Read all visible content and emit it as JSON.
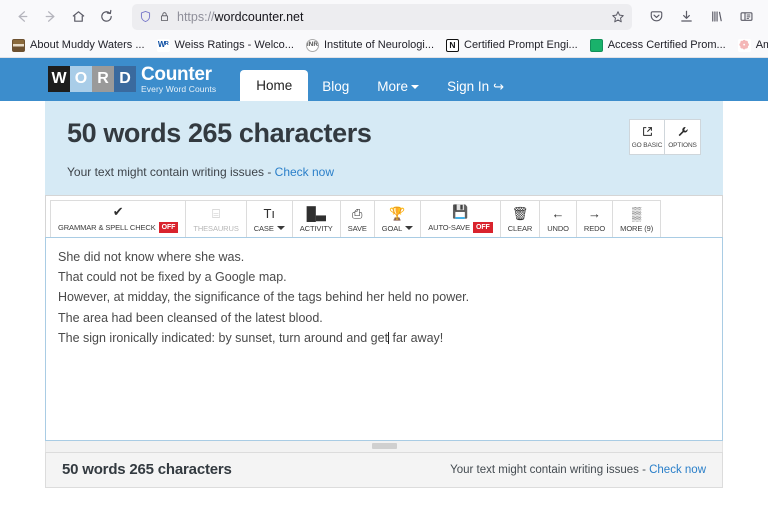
{
  "browser": {
    "nav_icons": [
      {
        "name": "back-button",
        "glyph": "←",
        "dim": true
      },
      {
        "name": "forward-button",
        "glyph": "→",
        "dim": true
      },
      {
        "name": "home-button",
        "glyph": "⌂",
        "dim": false
      },
      {
        "name": "reload-button",
        "glyph": "⟳",
        "dim": false
      }
    ],
    "url": {
      "scheme": "https://",
      "host": "wordcounter.net",
      "full": "https://wordcounter.net",
      "shield_icon": "shield-icon",
      "lock_icon": "padlock-icon",
      "star_icon": "bookmark-star-icon"
    },
    "right_icons": [
      {
        "name": "pocket-icon",
        "glyph": "♡"
      },
      {
        "name": "downloads-icon",
        "glyph": "⬇"
      },
      {
        "name": "library-icon",
        "glyph": "‖"
      },
      {
        "name": "sidebar-icon",
        "glyph": "▤"
      }
    ],
    "bookmarks": [
      {
        "label": "About Muddy Waters ...",
        "favicon": "muddy-waters-favicon",
        "fav_class": "fav-muddy",
        "fav_text": ""
      },
      {
        "label": "Weiss Ratings - Welco...",
        "favicon": "weiss-ratings-favicon",
        "fav_class": "fav-weiss",
        "fav_text": "Wᴿ"
      },
      {
        "label": "Institute of Neurologi...",
        "favicon": "institute-neurology-favicon",
        "fav_class": "fav-neuro",
        "fav_text": "INR"
      },
      {
        "label": "Certified Prompt Engi...",
        "favicon": "notion-favicon",
        "fav_class": "fav-notion",
        "fav_text": "N"
      },
      {
        "label": "Access Certified Prom...",
        "favicon": "access-certified-favicon",
        "fav_class": "fav-green",
        "fav_text": ""
      },
      {
        "label": "Amazon Ads fo",
        "favicon": "amazon-ads-favicon",
        "fav_class": "fav-amazon",
        "fav_text": "❁"
      }
    ]
  },
  "site": {
    "logo": {
      "blocks": [
        "W",
        "O",
        "R",
        "D"
      ],
      "word": "Counter",
      "tagline": "Every Word Counts"
    },
    "nav": [
      {
        "label": "Home",
        "active": true,
        "caret": false,
        "icon": ""
      },
      {
        "label": "Blog",
        "active": false,
        "caret": false,
        "icon": ""
      },
      {
        "label": "More",
        "active": false,
        "caret": true,
        "icon": ""
      },
      {
        "label": "Sign In",
        "active": false,
        "caret": false,
        "icon": "↪"
      }
    ],
    "header_bg": "#3c8dcc"
  },
  "counter": {
    "headline": "50 words 265 characters",
    "words": 50,
    "characters": 265,
    "issues_prefix": "Your text might contain writing issues - ",
    "issues_link": "Check now",
    "panel_bg": "#d6eaf5",
    "buttons": [
      {
        "name": "go-basic-button",
        "label": "GO BASIC",
        "icon": "⧉"
      },
      {
        "name": "options-button",
        "label": "OPTIONS",
        "icon": "🔧"
      }
    ]
  },
  "toolbar": [
    {
      "name": "grammar-spell-check-button",
      "label": "GRAMMAR & SPELL CHECK",
      "icon": "✔",
      "badge": "OFF",
      "disabled": false,
      "caret": false
    },
    {
      "name": "thesaurus-button",
      "label": "THESAURUS",
      "icon": "⌸",
      "badge": "",
      "disabled": true,
      "caret": false
    },
    {
      "name": "case-button",
      "label": "CASE",
      "icon": "Tı",
      "badge": "",
      "disabled": false,
      "caret": true
    },
    {
      "name": "activity-button",
      "label": "ACTIVITY",
      "icon": "█▃",
      "badge": "",
      "disabled": false,
      "caret": false
    },
    {
      "name": "save-button",
      "label": "SAVE",
      "icon": "⎙",
      "badge": "",
      "disabled": false,
      "caret": false
    },
    {
      "name": "goal-button",
      "label": "GOAL",
      "icon": "🏆",
      "badge": "",
      "disabled": false,
      "caret": true
    },
    {
      "name": "auto-save-button",
      "label": "AUTO-SAVE",
      "icon": "💾",
      "badge": "OFF",
      "disabled": false,
      "caret": false
    },
    {
      "name": "clear-button",
      "label": "CLEAR",
      "icon": "🗑",
      "badge": "",
      "disabled": false,
      "caret": false
    },
    {
      "name": "undo-button",
      "label": "UNDO",
      "icon": "←",
      "badge": "",
      "disabled": false,
      "caret": false
    },
    {
      "name": "redo-button",
      "label": "REDO",
      "icon": "→",
      "badge": "",
      "disabled": false,
      "caret": false
    },
    {
      "name": "more-button",
      "label": "MORE (9)",
      "icon": "▒",
      "badge": "",
      "disabled": false,
      "caret": false
    }
  ],
  "editor": {
    "lines": [
      "She did not know where she was.",
      "That could not be fixed by a Google map.",
      "However, at midday, the significance of the tags behind her held no power.",
      "The area had been cleansed of the latest blood.",
      "The sign ironically indicated: by sunset, turn around and get far away!"
    ],
    "caret_line_index": 4,
    "caret_after_text": "The sign ironically indicated: by sunset, turn around and get",
    "caret_rest_text": " far away!",
    "border_color": "#a9cce4"
  },
  "footer": {
    "count": "50 words 265 characters",
    "issues_prefix": "Your text might contain writing issues - ",
    "issues_link": "Check now"
  }
}
